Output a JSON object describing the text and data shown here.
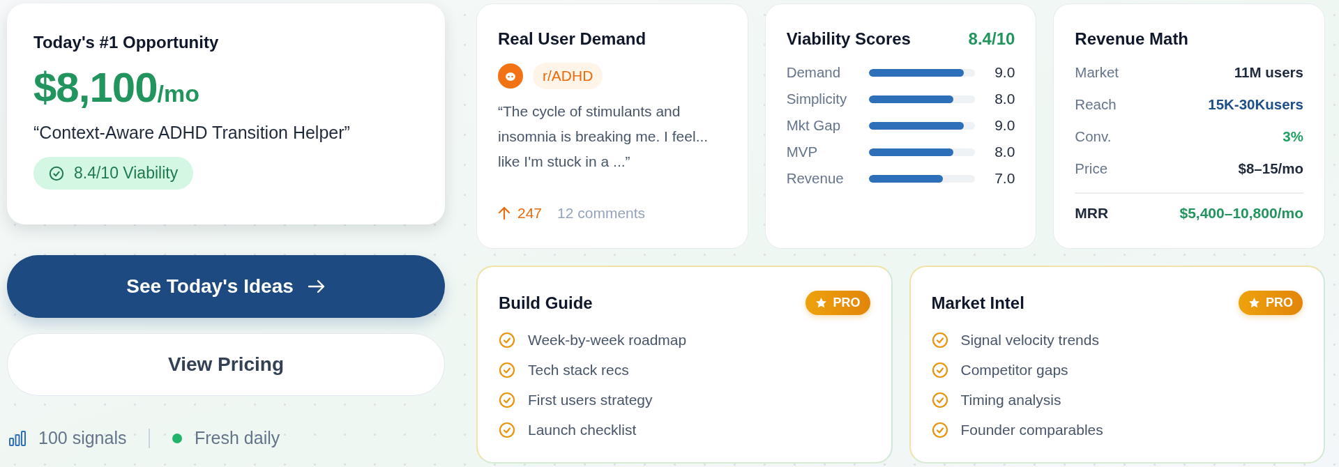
{
  "opportunity": {
    "title": "Today's #1 Opportunity",
    "amount": "$8,100",
    "unit": "/mo",
    "idea": "“Context-Aware ADHD Transition Helper”",
    "viability": "8.4/10 Viability"
  },
  "actions": [
    {
      "label": "See Today's Ideas",
      "kind": "primary"
    },
    {
      "label": "View Pricing",
      "kind": "secondary"
    }
  ],
  "footer": {
    "signals": "100 signals",
    "fresh": "Fresh daily"
  },
  "demand": {
    "title": "Real User Demand",
    "subreddit": "r/ADHD",
    "quote": "“The cycle of stimulants and insomnia is breaking me. I feel... like I'm stuck in a ...”",
    "upvotes": "247",
    "comments": "12 comments"
  },
  "viability": {
    "title": "Viability Scores",
    "total": "8.4/10",
    "scores": [
      {
        "label": "Demand",
        "level": 0.9,
        "value": "9.0"
      },
      {
        "label": "Simplicity",
        "level": 0.8,
        "value": "8.0"
      },
      {
        "label": "Mkt Gap",
        "level": 0.9,
        "value": "9.0"
      },
      {
        "label": "MVP",
        "level": 0.8,
        "value": "8.0"
      },
      {
        "label": "Revenue",
        "level": 0.7,
        "value": "7.0"
      }
    ]
  },
  "revenue": {
    "title": "Revenue Math",
    "rows": [
      {
        "label": "Market",
        "value": "11M users",
        "color": "#1e293b"
      },
      {
        "label": "Reach",
        "value": "15K-30Kusers",
        "color": "#1d4e89"
      },
      {
        "label": "Conv.",
        "value": "3%",
        "color": "#22a064"
      },
      {
        "label": "Price",
        "value": "$8–15/mo",
        "color": "#1e293b"
      }
    ],
    "total": {
      "label": "MRR",
      "value": "$5,400–10,800/mo"
    }
  },
  "pro_cards": [
    {
      "title": "Build Guide",
      "badge": "PRO",
      "items": [
        "Week-by-week roadmap",
        "Tech stack recs",
        "First users strategy",
        "Launch checklist"
      ]
    },
    {
      "title": "Market Intel",
      "badge": "PRO",
      "items": [
        "Signal velocity trends",
        "Competitor gaps",
        "Timing analysis",
        "Founder comparables"
      ]
    }
  ]
}
